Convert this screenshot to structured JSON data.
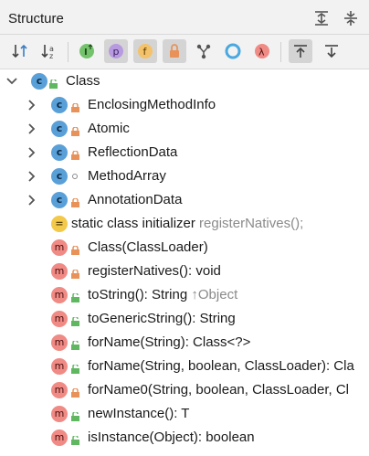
{
  "header": {
    "title": "Structure"
  },
  "toolbar": {
    "buttons": [
      {
        "name": "sort-by-visibility",
        "glyph": "↓⇂"
      },
      {
        "name": "sort-alphabetically",
        "glyph": "↓a"
      },
      {
        "name": "show-inherited",
        "glyph": "I"
      },
      {
        "name": "show-properties",
        "glyph": "p"
      },
      {
        "name": "show-fields",
        "glyph": "f"
      },
      {
        "name": "show-non-public",
        "glyph": "🔒"
      },
      {
        "name": "show-anonymous",
        "glyph": "Y"
      },
      {
        "name": "show-lambdas",
        "glyph": "○"
      },
      {
        "name": "show-lambda-symbol",
        "glyph": "λ"
      }
    ]
  },
  "tree": {
    "root": {
      "label": "Class"
    },
    "inner_classes": [
      {
        "label": "EnclosingMethodInfo",
        "visibility": "private"
      },
      {
        "label": "Atomic",
        "visibility": "private"
      },
      {
        "label": "ReflectionData",
        "visibility": "private"
      },
      {
        "label": "MethodArray",
        "visibility": "package"
      },
      {
        "label": "AnnotationData",
        "visibility": "private"
      }
    ],
    "initializer": {
      "label": "static class initializer",
      "detail": "registerNatives();"
    },
    "members": [
      {
        "label": "Class(ClassLoader)",
        "detail": "",
        "visibility": "private"
      },
      {
        "label": "registerNatives(): void",
        "detail": "",
        "visibility": "private"
      },
      {
        "label": "toString(): String",
        "detail": "↑Object",
        "visibility": "public"
      },
      {
        "label": "toGenericString(): String",
        "detail": "",
        "visibility": "public"
      },
      {
        "label": "forName(String): Class<?>",
        "detail": "",
        "visibility": "public"
      },
      {
        "label": "forName(String, boolean, ClassLoader): Cla",
        "detail": "",
        "visibility": "public"
      },
      {
        "label": "forName0(String, boolean, ClassLoader, Cl",
        "detail": "",
        "visibility": "private"
      },
      {
        "label": "newInstance(): T",
        "detail": "",
        "visibility": "public"
      },
      {
        "label": "isInstance(Object): boolean",
        "detail": "",
        "visibility": "public"
      }
    ]
  },
  "colors": {
    "lock": "#e8925a",
    "public": "#5fb85f",
    "class_icon": "#5aa0d8",
    "method_icon": "#f08a84",
    "static_icon": "#f3c94a"
  }
}
